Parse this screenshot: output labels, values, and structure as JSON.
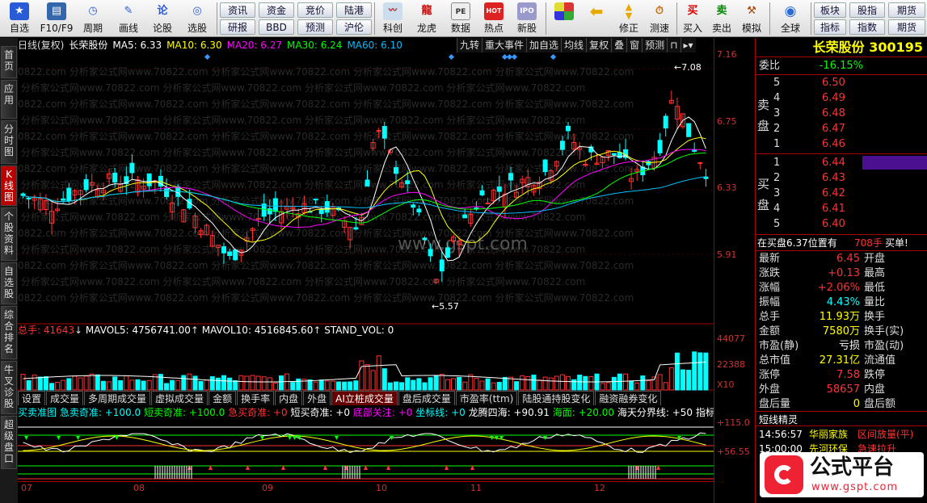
{
  "toolbar": {
    "items": [
      {
        "label": "自选",
        "icon": "star-icon"
      },
      {
        "label": "F10/F9",
        "icon": "f10-icon"
      },
      {
        "label": "周期",
        "icon": "clock-icon"
      },
      {
        "label": "画线",
        "icon": "pencil-icon"
      },
      {
        "label": "论股",
        "icon": "discuss-icon"
      },
      {
        "label": "选股",
        "icon": "chart-search-icon"
      },
      {
        "label": "科创",
        "icon": "kechuang-icon"
      },
      {
        "label": "龙虎",
        "icon": "dragon-tiger-icon"
      },
      {
        "label": "数据",
        "icon": "pe-icon"
      },
      {
        "label": "热点",
        "icon": "hot-icon"
      },
      {
        "label": "新股",
        "icon": "ipo-icon"
      },
      {
        "label": "修正",
        "icon": "up-down-icon"
      },
      {
        "label": "测速",
        "icon": "speed-icon"
      },
      {
        "label": "买入",
        "icon": "buy-icon"
      },
      {
        "label": "卖出",
        "icon": "sell-icon"
      },
      {
        "label": "模拟",
        "icon": "hammer-icon"
      },
      {
        "label": "全球",
        "icon": "globe-icon"
      }
    ],
    "small_buttons": [
      "资讯",
      "资金",
      "竞价",
      "陆港",
      "研报",
      "BBD",
      "预测",
      "沪伦"
    ],
    "right_buttons": [
      "板块",
      "股指",
      "指标",
      "指数",
      "期货",
      "期货"
    ]
  },
  "sidebar": [
    "首页",
    "应用",
    "分时图",
    "K线图",
    "个股资料",
    "自选股",
    "综合排名",
    "牛叉诊股",
    "超级盘口"
  ],
  "chart": {
    "header": {
      "period": "日线(复权)",
      "name": "长荣股份",
      "ma5": "MA5: 6.33",
      "ma10": "MA10: 6.30",
      "ma20": "MA20: 6.27",
      "ma30": "MA30: 6.24",
      "ma60": "MA60: 6.10"
    },
    "buttons": [
      "九转",
      "重大事件",
      "加自选",
      "均线",
      "复权",
      "叠",
      "窗",
      "预测"
    ],
    "price_axis": [
      "7.16",
      "6.75",
      "6.33",
      "5.91",
      "44077",
      "22388",
      "X10",
      "+115.0",
      "+56.55"
    ],
    "high_label": "7.08",
    "low_label": "5.57",
    "watermark": "www.gspt.com",
    "watermark_repeat": "0822.com  分析家公式网www.70822.com  分析家公式网www.70822.com  分析家公式网www.70822.com  分析家公式网www.70822.com",
    "volume_info": {
      "total": "总手: 41643",
      "mavol5": "MAVOL5: 4756741.00",
      "mavol10": "MAVOL10: 4516845.60",
      "stand": "STAND_VOL: 0"
    },
    "tabs": [
      "设置",
      "成交量",
      "多周期成交量",
      "虚拟成交量",
      "金额",
      "换手率",
      "内盘",
      "外盘",
      "AI立桩成交量",
      "盘后成交量",
      "市盈率(ttm)",
      "陆股通持股变化",
      "融资融券变化"
    ],
    "active_tab": "AI立桩成交量",
    "indicator": {
      "name": "买卖准图",
      "a": "急卖奇准: +100.0",
      "b": "短卖奇准: +100.0",
      "c": "急买奇准: +0",
      "d": "短买奇准: +0",
      "e": "底部关注: +0",
      "f": "坐标线: +0",
      "g": "龙腾四海: +90.91",
      "h": "海面: +20.00",
      "i": "海天分界线: +50",
      "j": "指标说明"
    },
    "dates": [
      "07",
      "08",
      "09",
      "10",
      "11",
      "12"
    ]
  },
  "panel": {
    "stock": "长荣股份 300195",
    "webi": {
      "label": "委比",
      "value": "-16.15%"
    },
    "sell_label": "卖盘",
    "buy_label": "买盘",
    "asks": [
      {
        "lv": "5",
        "p": "6.50"
      },
      {
        "lv": "4",
        "p": "6.49"
      },
      {
        "lv": "3",
        "p": "6.48"
      },
      {
        "lv": "2",
        "p": "6.47"
      },
      {
        "lv": "1",
        "p": "6.46"
      }
    ],
    "bids": [
      {
        "lv": "1",
        "p": "6.44"
      },
      {
        "lv": "2",
        "p": "6.43"
      },
      {
        "lv": "3",
        "p": "6.42"
      },
      {
        "lv": "4",
        "p": "6.41"
      },
      {
        "lv": "5",
        "p": "6.40"
      }
    ],
    "notice": {
      "text": "在买盘6.37位置有",
      "qty": "708手",
      "tag": "买单!"
    },
    "stats": [
      {
        "k": "最新",
        "v": "6.45",
        "vc": "red",
        "k2": "开盘",
        "v2": ""
      },
      {
        "k": "涨跌",
        "v": "+0.13",
        "vc": "red",
        "k2": "最高",
        "v2": ""
      },
      {
        "k": "涨幅",
        "v": "+2.06%",
        "vc": "red",
        "k2": "最低",
        "v2": ""
      },
      {
        "k": "振幅",
        "v": "4.43%",
        "vc": "cyan",
        "k2": "量比",
        "v2": ""
      },
      {
        "k": "总手",
        "v": "11.93万",
        "vc": "yellow",
        "k2": "换手",
        "v2": ""
      },
      {
        "k": "金额",
        "v": "7580万",
        "vc": "yellow",
        "k2": "换手(实)",
        "v2": ""
      },
      {
        "k": "市盈(静)",
        "v": "亏损",
        "vc": "white",
        "k2": "市盈(动)",
        "v2": ""
      },
      {
        "k": "总市值",
        "v": "27.31亿",
        "vc": "yellow",
        "k2": "流通值",
        "v2": ""
      },
      {
        "k": "涨停",
        "v": "7.58",
        "vc": "red",
        "k2": "跌停",
        "v2": ""
      },
      {
        "k": "外盘",
        "v": "58657",
        "vc": "red",
        "k2": "内盘",
        "v2": ""
      },
      {
        "k": "盘后量",
        "v": "0",
        "vc": "yellow",
        "k2": "盘后额",
        "v2": ""
      }
    ],
    "elf": {
      "title": "短线精灵",
      "rows": [
        {
          "t": "14:56:57",
          "n": "华丽家族",
          "e": "区间放量(平)"
        },
        {
          "t": "15:00:00",
          "n": "先河环保",
          "e": "急速拉升"
        }
      ]
    },
    "logo_text": "公式平台",
    "logo_url": "www.gspt.com"
  },
  "colors": {
    "up": "#ff3333",
    "down": "#00ffff",
    "ma5": "#ffffff",
    "ma10": "#ffff00",
    "ma20": "#ff00ff",
    "ma30": "#00ff00",
    "ma60": "#00bfff",
    "frame": "#aa0000"
  }
}
